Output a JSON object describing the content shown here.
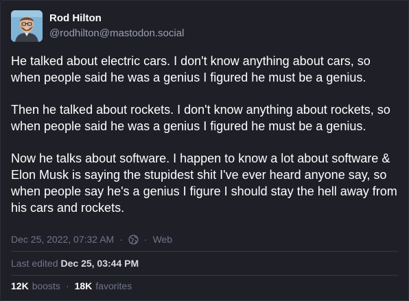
{
  "author": {
    "display_name": "Rod Hilton",
    "handle": "@rodhilton@mastodon.social",
    "avatar_icon": "user-avatar-portrait"
  },
  "post": {
    "paragraphs": [
      "He talked about electric cars. I don't know anything about cars, so when people said he was a genius I figured he must be a genius.",
      "Then he talked about rockets. I don't know anything about rockets, so when people said he was a genius I figured he must be a genius.",
      "Now he talks about software. I happen to know a lot about software & Elon Musk is saying the stupidest shit I've ever heard anyone say, so when people say he's a genius I figure I should stay the hell away from his cars and rockets."
    ]
  },
  "meta": {
    "timestamp": "Dec 25, 2022, 07:32 AM",
    "separator": "·",
    "visibility_icon": "globe-icon",
    "application": "Web"
  },
  "edited": {
    "label": "Last edited",
    "date": "Dec 25, 03:44 PM"
  },
  "stats": {
    "boosts_count": "12K",
    "boosts_label": "boosts",
    "separator": "·",
    "favorites_count": "18K",
    "favorites_label": "favorites"
  },
  "colors": {
    "background": "#1f1f27",
    "text": "#ffffff",
    "muted": "#70758a",
    "handle": "#9aa0b2"
  }
}
